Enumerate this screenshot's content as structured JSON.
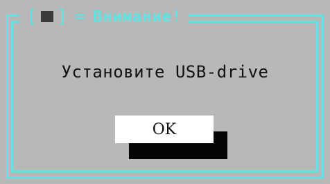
{
  "dialog": {
    "title": "Внимание!",
    "message": "Установите USB-drive",
    "ok_label": "OK",
    "close_icon": "close-square-icon"
  },
  "colors": {
    "background": "#b8b8b8",
    "frame_accent": "#5fe3e3",
    "text": "#111111",
    "button_bg": "#ffffff",
    "button_shadow": "#050505"
  }
}
